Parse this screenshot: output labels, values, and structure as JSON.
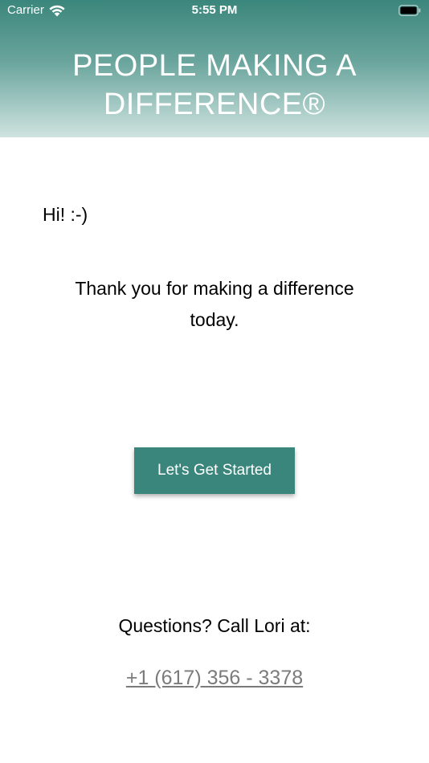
{
  "status_bar": {
    "carrier": "Carrier",
    "time": "5:55 PM",
    "wifi_icon": "wifi-icon",
    "battery_icon": "battery-icon"
  },
  "header": {
    "title": "PEOPLE MAKING A DIFFERENCE®"
  },
  "main": {
    "greeting": "Hi! :-)",
    "thanks": "Thank you for making a difference today.",
    "cta_label": "Let's Get Started"
  },
  "footer": {
    "questions": "Questions? Call Lori at:",
    "phone": "+1 (617) 356 - 3378"
  },
  "colors": {
    "brand": "#3b867c",
    "link": "#7b7b7b",
    "header_text": "#ffffff"
  }
}
